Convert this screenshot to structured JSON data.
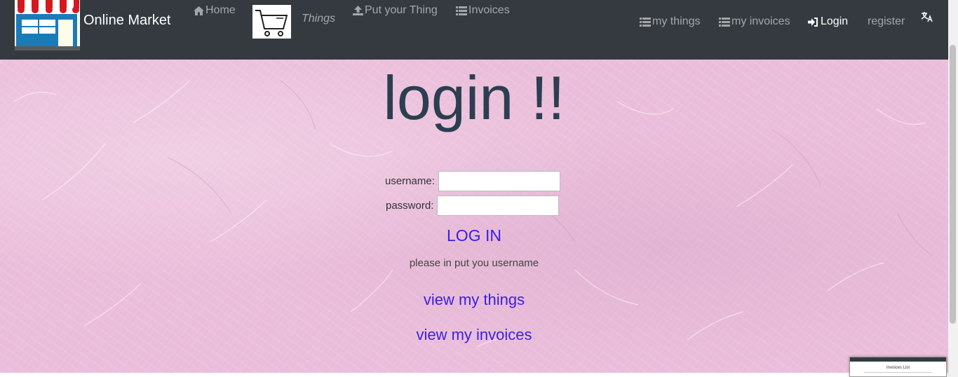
{
  "navbar": {
    "brand_name": "Online Market",
    "home": "Home",
    "things": "Things",
    "put_thing": "Put your Thing",
    "invoices": "Invoices",
    "my_things": "my things",
    "my_invoices": "my invoices",
    "login": "Login",
    "register": "register"
  },
  "main": {
    "title": "login !!",
    "username_label": "username:",
    "password_label": "password:",
    "username_value": "",
    "password_value": "",
    "login_button": "LOG IN",
    "hint": "please in put you username",
    "view_things": "view my things",
    "view_invoices": "view my invoices"
  },
  "preview": {
    "title": "Invoices List"
  },
  "colors": {
    "navbar_bg": "#343a40",
    "page_bg": "#ebbfdb",
    "title": "#2c3e50",
    "link": "#3a1ee6"
  },
  "icons": [
    "home-icon",
    "cart-icon",
    "upload-icon",
    "list-icon",
    "login-icon",
    "language-icon"
  ]
}
